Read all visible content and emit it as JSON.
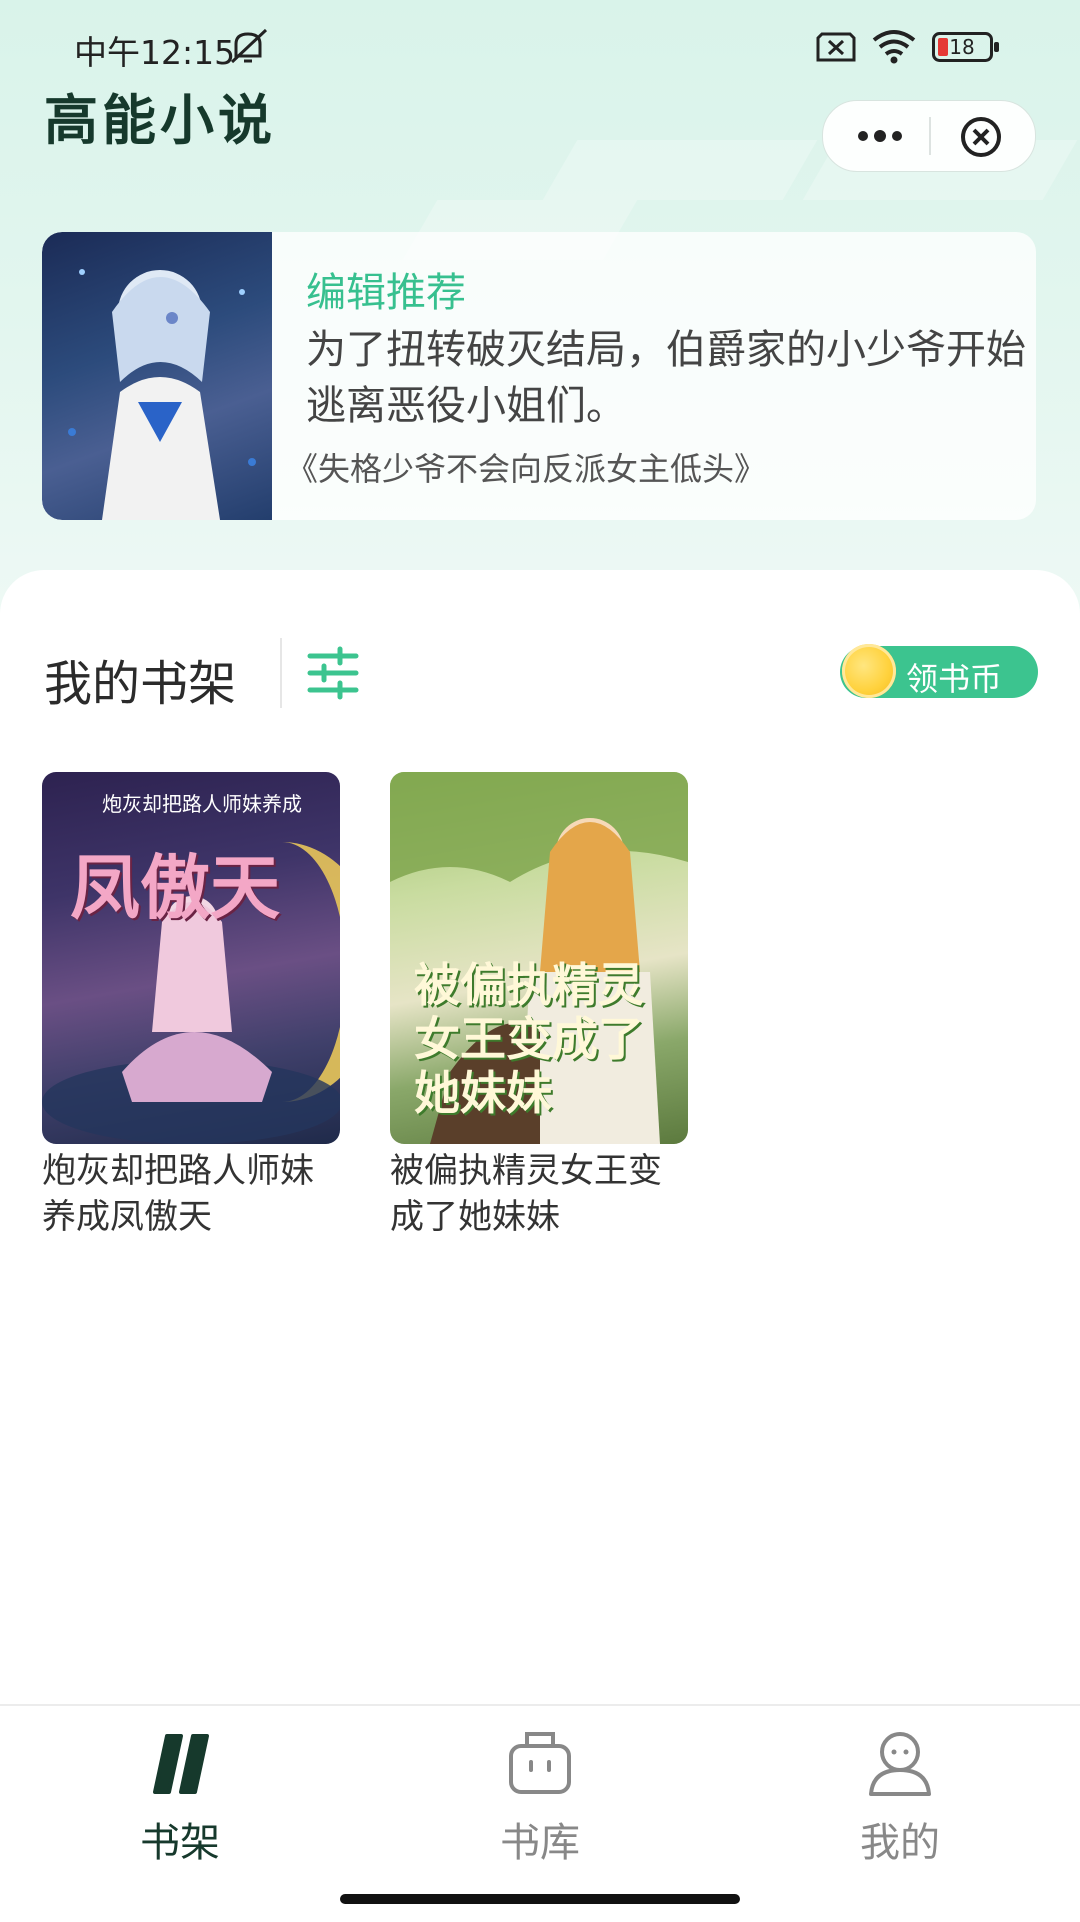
{
  "status_bar": {
    "time": "中午12:15",
    "battery": "18"
  },
  "header": {
    "app_title": "高能小说"
  },
  "recommendation": {
    "label": "编辑推荐",
    "description": "为了扭转破灭结局，伯爵家的小少爷开始逃离恶役小姐们。",
    "book_title": "《失格少爷不会向反派女主低头》"
  },
  "shelf": {
    "title": "我的书架",
    "coins_button": "领书币",
    "books": [
      {
        "title": "炮灰却把路人师妹养成凤傲天",
        "cover_text": "凤傲天",
        "cover_subtitle": "炮灰却把路人师妹养成"
      },
      {
        "title": "被偏执精灵女王变成了她妹妹",
        "cover_text": "被偏执精灵女王变成了她妹妹"
      }
    ]
  },
  "nav": {
    "items": [
      {
        "label": "书架",
        "icon": "bookshelf-icon",
        "active": true
      },
      {
        "label": "书库",
        "icon": "library-icon",
        "active": false
      },
      {
        "label": "我的",
        "icon": "profile-icon",
        "active": false
      }
    ]
  },
  "colors": {
    "accent": "#3cc48f",
    "title": "#16392c",
    "nav_active": "#16392c",
    "nav_inactive": "#888888"
  }
}
